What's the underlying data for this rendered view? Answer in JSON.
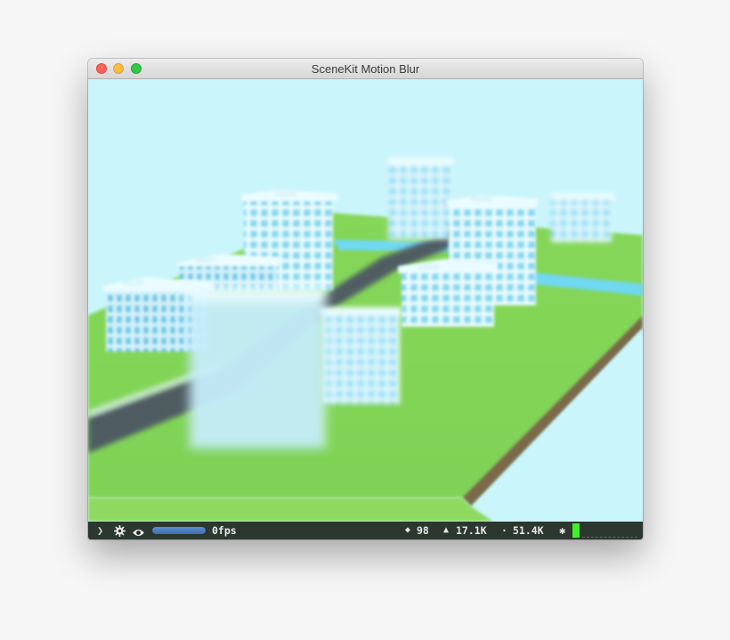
{
  "window": {
    "title": "SceneKit Motion Blur",
    "buttons": {
      "close": "close",
      "minimize": "minimize",
      "zoom": "zoom"
    }
  },
  "scene": {
    "sky_color": "#c9f5fb",
    "ground_color": "#8fe05a",
    "road_color": "#4f5d63",
    "water_color": "#6fd8f0",
    "building_color": "#e8fbff",
    "window_color": "#7fd6f3"
  },
  "stats_bar": {
    "expand_icon": "chevron-right-icon",
    "settings_icon": "gear-icon",
    "visibility_icon": "eye-icon",
    "progress": 1.0,
    "fps": "0fps",
    "nodes_icon": "◆",
    "nodes": "98",
    "triangles_icon": "▲",
    "triangles": "17.1K",
    "vertices_icon": "·",
    "vertices": "51.4K",
    "draw_icon": "✱",
    "meter_color": "#40f028"
  }
}
